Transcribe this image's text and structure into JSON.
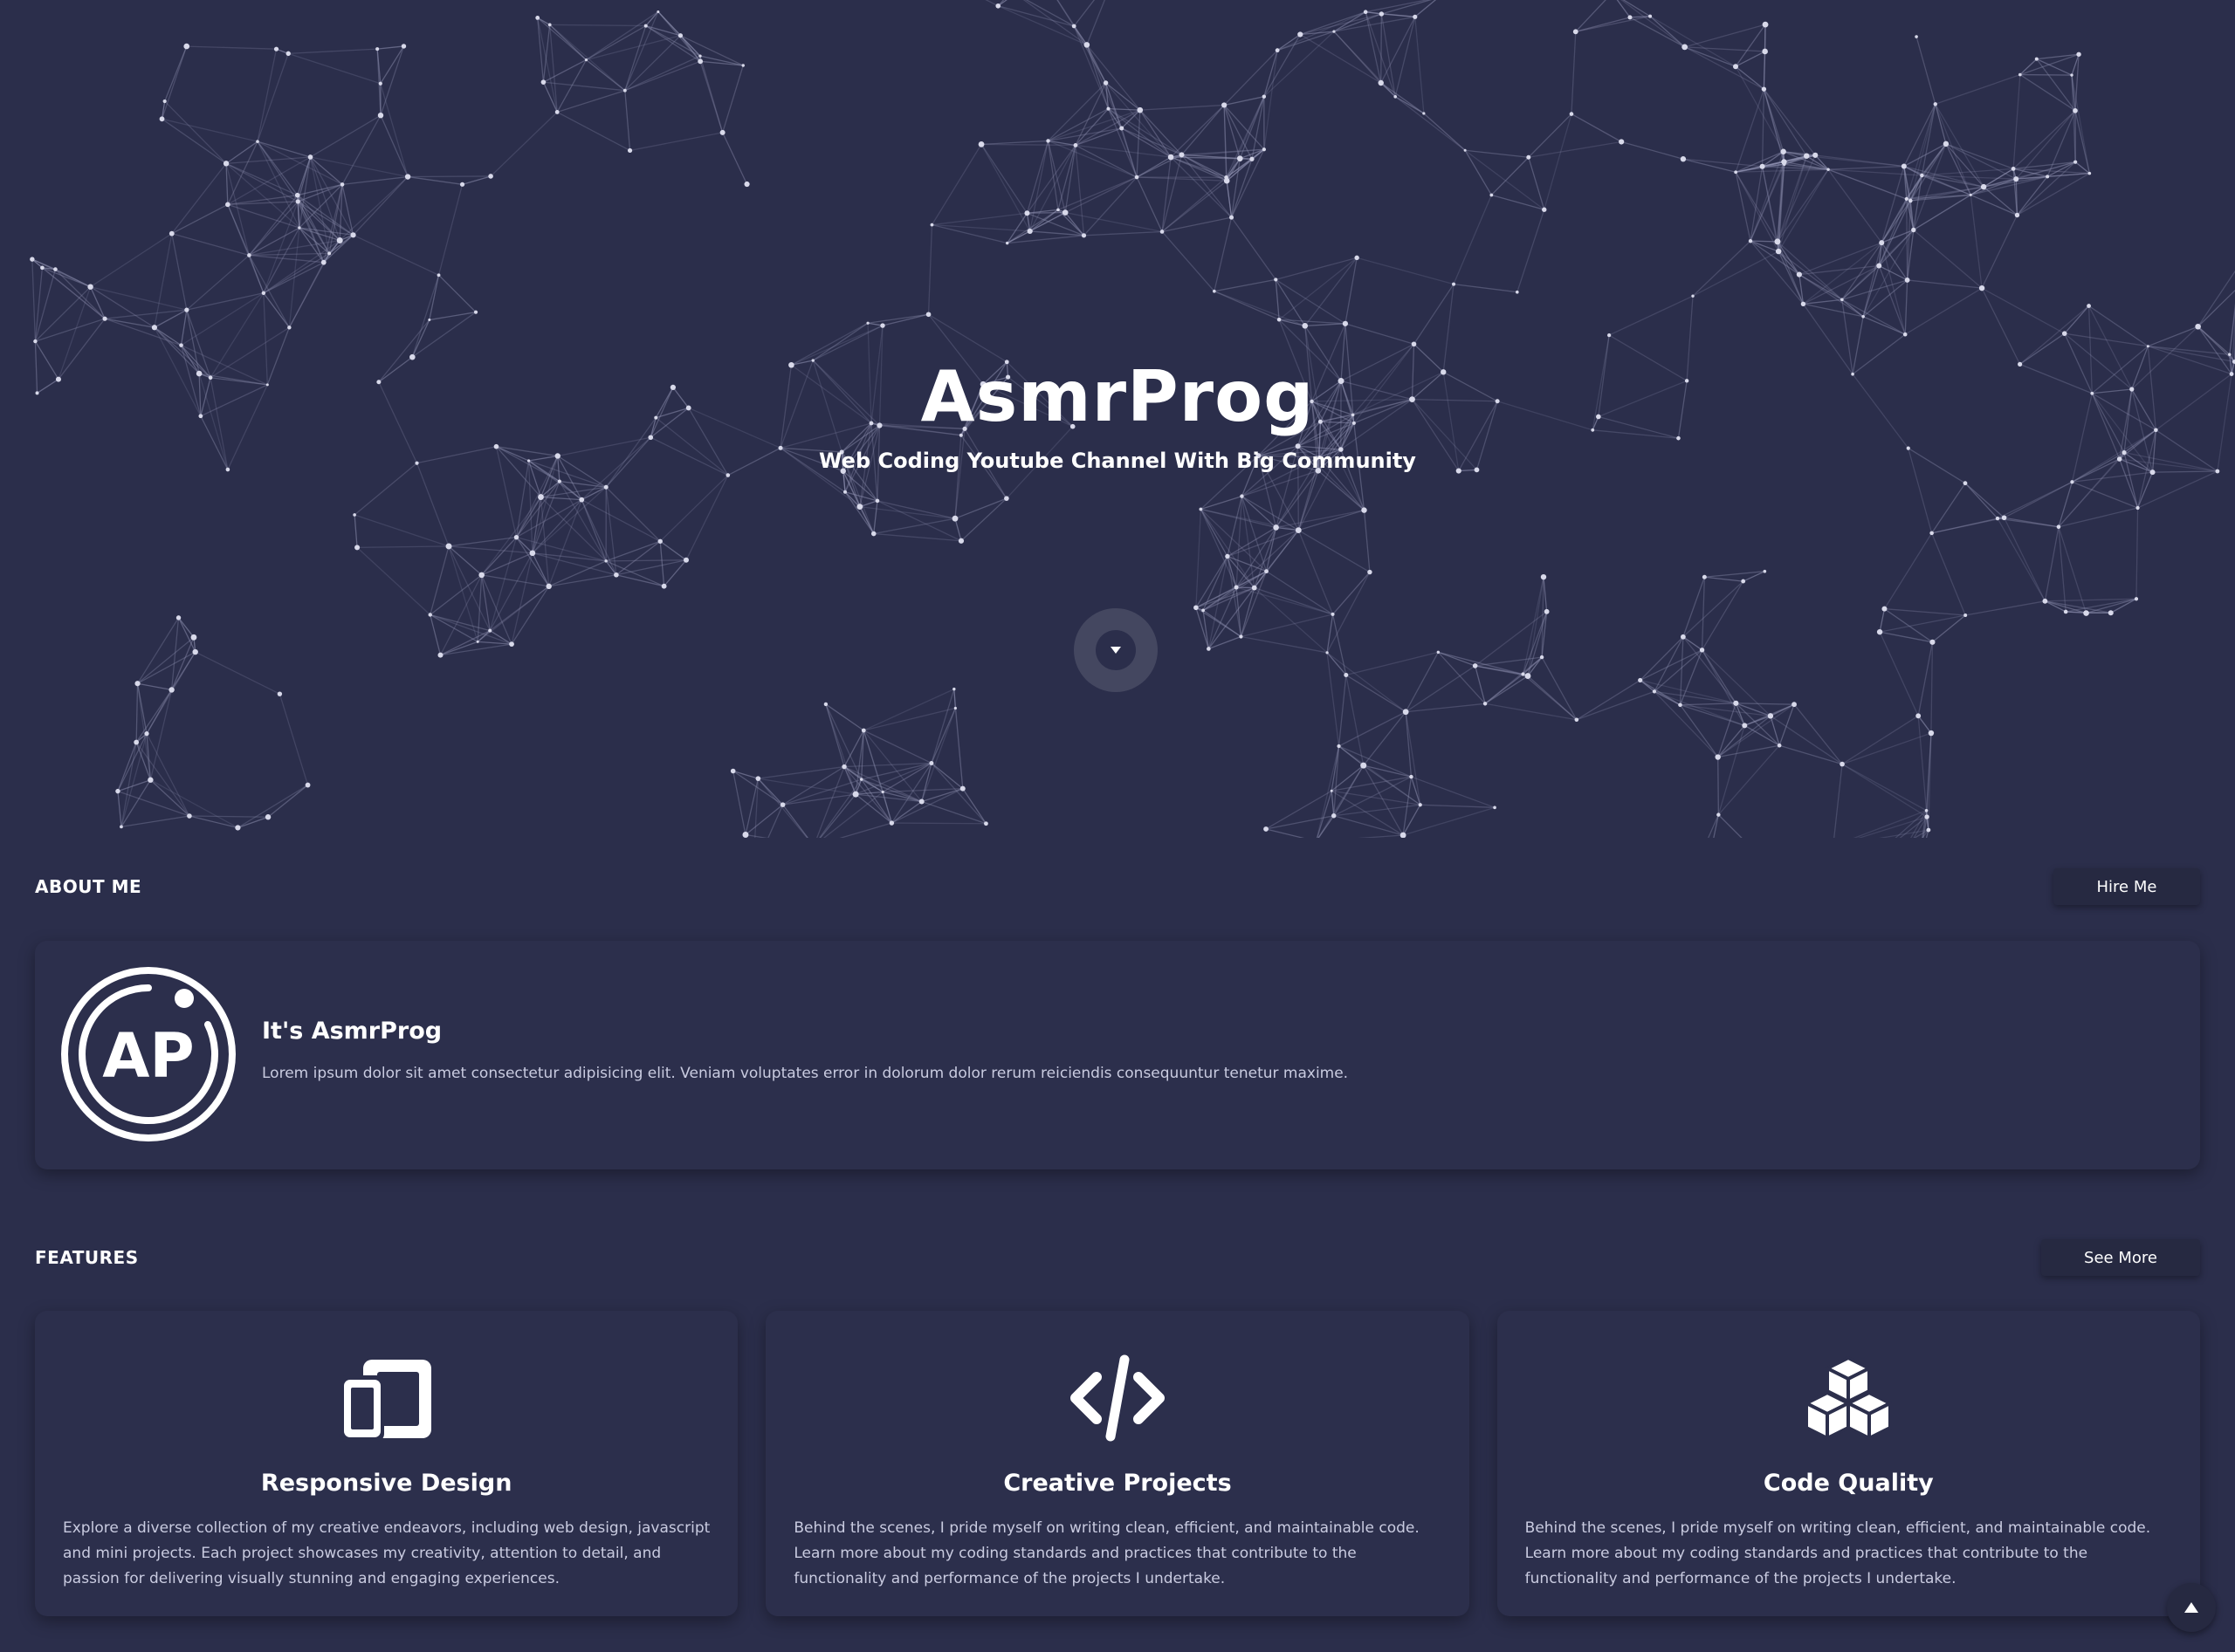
{
  "hero": {
    "title": "AsmrProg",
    "subtitle": "Web Coding Youtube Channel With Big Community"
  },
  "about": {
    "section_title": "ABOUT ME",
    "hire_label": "Hire Me",
    "logo_text": "AP",
    "name": "It's AsmrProg",
    "text": "Lorem ipsum dolor sit amet consectetur adipisicing elit. Veniam voluptates error in dolorum dolor rerum reiciendis consequuntur tenetur maxime."
  },
  "features": {
    "section_title": "FEATURES",
    "see_more_label": "See More",
    "items": [
      {
        "icon": "tablet-mobile-icon",
        "title": "Responsive Design",
        "text": "Explore a diverse collection of my creative endeavors, including web design, javascript and mini projects. Each project showcases my creativity, attention to detail, and passion for delivering visually stunning and engaging experiences."
      },
      {
        "icon": "code-icon",
        "title": "Creative Projects",
        "text": "Behind the scenes, I pride myself on writing clean, efficient, and maintainable code. Learn more about my coding standards and practices that contribute to the functionality and performance of the projects I undertake."
      },
      {
        "icon": "cubes-icon",
        "title": "Code Quality",
        "text": "Behind the scenes, I pride myself on writing clean, efficient, and maintainable code. Learn more about my coding standards and practices that contribute to the functionality and performance of the projects I undertake."
      }
    ]
  },
  "colors": {
    "background": "#2b2e4b",
    "card": "#2c2f4c",
    "button": "#262941",
    "text": "#ffffff",
    "muted_text": "#c9cbe0"
  }
}
